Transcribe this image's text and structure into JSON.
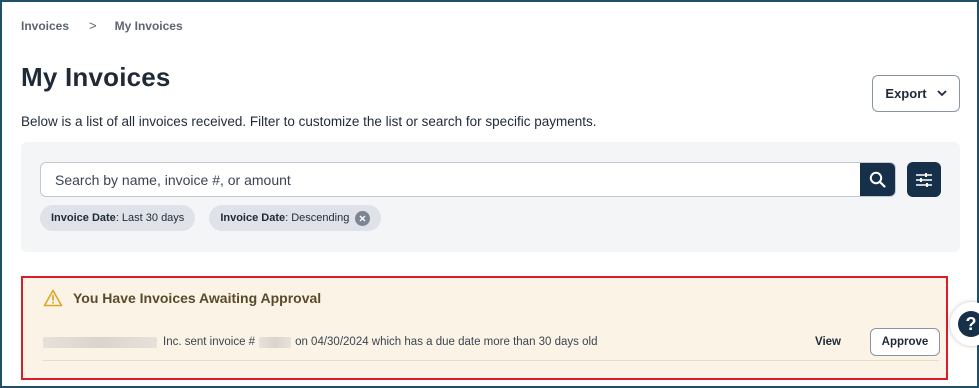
{
  "breadcrumb": {
    "items": [
      "Invoices",
      "My Invoices"
    ],
    "separator": ">"
  },
  "page": {
    "title": "My Invoices",
    "description": "Below is a list of all invoices received. Filter to customize the list or search for specific payments."
  },
  "toolbar": {
    "export_label": "Export"
  },
  "search": {
    "placeholder": "Search by name, invoice #, or amount",
    "value": ""
  },
  "filters": [
    {
      "label": "Invoice Date",
      "value": ": Last 30 days",
      "clearable": false
    },
    {
      "label": "Invoice Date",
      "value": ": Descending",
      "clearable": true
    }
  ],
  "alert": {
    "title": "You Have Invoices Awaiting Approval",
    "row": {
      "text_part1": "Inc. sent invoice #",
      "text_part2": "on 04/30/2024 which has a due date more than 30 days old",
      "view_label": "View",
      "approve_label": "Approve"
    }
  },
  "help": {
    "label": "?"
  },
  "colors": {
    "primary_dark": "#17304a",
    "alert_border": "#d61f26",
    "alert_bg": "#fbf4e6",
    "warning_icon": "#e0a32a"
  },
  "icons": [
    "chevron-right-icon",
    "chevron-down-icon",
    "search-icon",
    "sliders-icon",
    "close-icon",
    "warning-icon",
    "help-icon"
  ]
}
